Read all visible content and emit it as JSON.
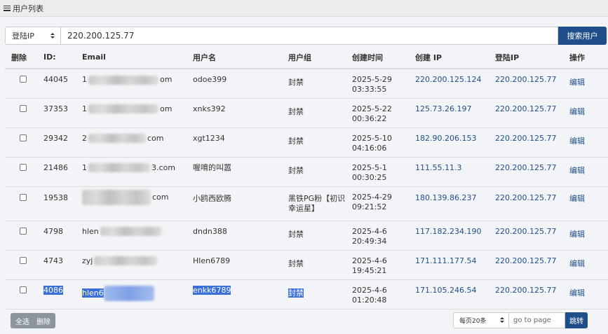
{
  "header": {
    "title": "用户列表",
    "icon": "list-icon"
  },
  "search": {
    "field": "登陆IP",
    "value": "220.200.125.77",
    "button": "搜索用户"
  },
  "columns": {
    "delete": "删除",
    "id": "ID:",
    "email": "Email",
    "username": "用户名",
    "group": "用户组",
    "created_time": "创建时间",
    "created_ip": "创建 IP",
    "login_ip": "登陆IP",
    "action": "操作"
  },
  "rows": [
    {
      "id": "44045",
      "email_start": "1",
      "email_end": "om",
      "username": "odoe399",
      "group": "封禁",
      "date": "2025-5-29",
      "time": "03:33:55",
      "created_ip": "220.200.125.124",
      "login_ip": "220.200.125.77",
      "action": "编辑"
    },
    {
      "id": "37353",
      "email_start": "1",
      "email_end": "om",
      "username": "xnks392",
      "group": "封禁",
      "date": "2025-5-22",
      "time": "00:36:22",
      "created_ip": "125.73.26.197",
      "login_ip": "220.200.125.77",
      "action": "编辑"
    },
    {
      "id": "29342",
      "email_start": "2",
      "email_end": "com",
      "username": "xgt1234",
      "group": "封禁",
      "date": "2025-5-10",
      "time": "04:16:06",
      "created_ip": "182.90.206.153",
      "login_ip": "220.200.125.77",
      "action": "编辑"
    },
    {
      "id": "21486",
      "email_start": "1",
      "email_end": "3.com",
      "username": "喔唷的叫嚣",
      "group": "封禁",
      "date": "2025-5-1",
      "time": "00:30:25",
      "created_ip": "111.55.11.3",
      "login_ip": "220.200.125.77",
      "action": "编辑"
    },
    {
      "id": "19538",
      "email_start": "",
      "email_end": "com",
      "username": "小鸥西欧腾",
      "group": "黑铁PG粉【初识幸运星】",
      "date": "2025-4-29",
      "time": "09:21:52",
      "created_ip": "180.139.86.237",
      "login_ip": "220.200.125.77",
      "action": "编辑"
    },
    {
      "id": "4798",
      "email_start": "hlen",
      "email_end": "",
      "username": "dndn388",
      "group": "封禁",
      "date": "2025-4-6",
      "time": "20:49:34",
      "created_ip": "117.182.234.190",
      "login_ip": "220.200.125.77",
      "action": "编辑"
    },
    {
      "id": "4743",
      "email_start": "zyj",
      "email_end": "",
      "username": "Hlen6789",
      "group": "封禁",
      "date": "2025-4-6",
      "time": "19:45:21",
      "created_ip": "171.111.177.54",
      "login_ip": "220.200.125.77",
      "action": "编辑"
    },
    {
      "id": "4086",
      "email_start": "hlen6",
      "email_end": "",
      "username": "enkk6789",
      "group": "封禁",
      "date": "2025-4-6",
      "time": "01:20:48",
      "created_ip": "171.105.246.54",
      "login_ip": "220.200.125.77",
      "action": "编辑"
    }
  ],
  "footer": {
    "select_all": "全选",
    "delete": "删除",
    "per_page": "每页20条",
    "goto_placeholder": "go to page",
    "jump": "跳转"
  },
  "colors": {
    "accent": "#1f4e8a",
    "selection": "#3b6fd8"
  }
}
